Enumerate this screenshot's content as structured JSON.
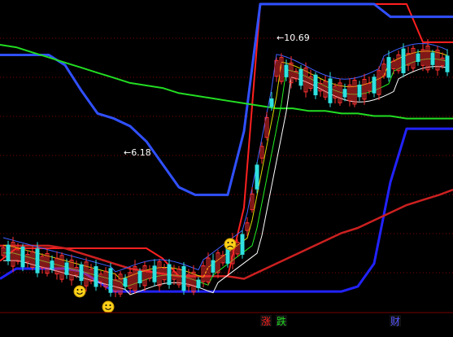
{
  "chart_data": {
    "type": "line",
    "title": "",
    "xlabel": "",
    "ylabel": "",
    "x": [
      0,
      20,
      40,
      60,
      80,
      100,
      120,
      140,
      160,
      180,
      200,
      220,
      240,
      260,
      280,
      300,
      320,
      340,
      360,
      380,
      400,
      420,
      440,
      460,
      480,
      500,
      520,
      540,
      557
    ],
    "ylim": [
      0,
      12
    ],
    "grid": true,
    "series": [
      {
        "color": "#ff2020",
        "values": [
          1.9,
          2.4,
          2.4,
          2.4,
          2.4,
          2.4,
          2.4,
          2.4,
          2.4,
          2.4,
          2.0,
          1.3,
          1.3,
          1.3,
          1.3,
          4.0,
          12.0,
          12.0,
          12.0,
          12.0,
          12.0,
          12.0,
          12.0,
          12.0,
          12.0,
          12.0,
          10.5,
          10.5,
          10.5
        ]
      },
      {
        "color": "#2222ff",
        "values": [
          1.2,
          1.6,
          1.6,
          1.6,
          1.6,
          1.5,
          1.1,
          0.7,
          0.7,
          0.7,
          0.7,
          0.7,
          0.7,
          0.7,
          0.7,
          0.7,
          0.7,
          0.7,
          0.7,
          0.7,
          0.7,
          0.7,
          0.9,
          1.8,
          5.0,
          7.1,
          7.1,
          7.1,
          7.1
        ]
      },
      {
        "color": "#3050ff",
        "values": [
          10.0,
          10.0,
          10.0,
          10.0,
          9.6,
          8.6,
          7.7,
          7.5,
          7.2,
          6.6,
          5.7,
          4.8,
          4.5,
          4.5,
          4.5,
          7.0,
          12.0,
          12.0,
          12.0,
          12.0,
          12.0,
          12.0,
          12.0,
          12.0,
          11.5,
          11.5,
          11.5,
          11.5,
          11.5
        ]
      },
      {
        "color": "#22dd22",
        "values": [
          10.4,
          10.3,
          10.1,
          9.9,
          9.7,
          9.5,
          9.3,
          9.1,
          8.9,
          8.8,
          8.7,
          8.5,
          8.4,
          8.3,
          8.2,
          8.1,
          8.0,
          7.9,
          7.9,
          7.8,
          7.8,
          7.7,
          7.7,
          7.6,
          7.6,
          7.5,
          7.5,
          7.5,
          7.5
        ]
      },
      {
        "color": "#cc2020",
        "values": [
          2.5,
          2.5,
          2.5,
          2.5,
          2.4,
          2.2,
          2.0,
          1.8,
          1.6,
          1.5,
          1.4,
          1.3,
          1.3,
          1.3,
          1.3,
          1.2,
          1.5,
          1.8,
          2.1,
          2.4,
          2.7,
          3.0,
          3.2,
          3.5,
          3.8,
          4.1,
          4.3,
          4.5,
          4.7
        ]
      }
    ],
    "price_labels": [
      {
        "x": 350,
        "y": 10.69,
        "text": "10.69"
      },
      {
        "x": 162,
        "y": 6.18,
        "text": "6.18"
      }
    ],
    "markers": [
      "smile",
      "smile",
      "frown"
    ],
    "footer_tags": [
      {
        "text": "涨",
        "color": "#ff2020"
      },
      {
        "text": "跌",
        "color": "#22dd22"
      },
      {
        "text": "财",
        "color": "#5555ff"
      }
    ]
  }
}
